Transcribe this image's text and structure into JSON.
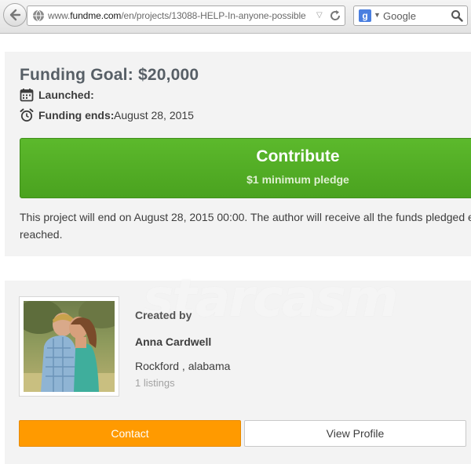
{
  "browser": {
    "url_prefix": "www.",
    "url_host": "fundme.com",
    "url_path": "/en/projects/13088-HELP-In-anyone-possible",
    "search_placeholder": "Google",
    "search_engine_icon": "google-g-icon"
  },
  "funding": {
    "goal": "Funding Goal: $20,000",
    "launched_label": "Launched:",
    "ends_label": "Funding ends:",
    "ends_value": "August 28, 2015",
    "contribute_label": "Contribute",
    "contribute_sub": "$1 minimum pledge",
    "end_notice": "This project will end on August 28, 2015 00:00. The author will receive all the funds pledged ev reached."
  },
  "creator": {
    "watermark": "starcasm",
    "created_by_label": "Created by",
    "name": "Anna Cardwell",
    "location": "Rockford , alabama",
    "listings": "1 listings",
    "contact_label": "Contact",
    "view_profile_label": "View Profile"
  },
  "colors": {
    "contribute_green": "#52ad24",
    "contact_orange": "#ff9a00",
    "panel_bg": "#f3f3f3",
    "goal_text": "#575f66"
  }
}
